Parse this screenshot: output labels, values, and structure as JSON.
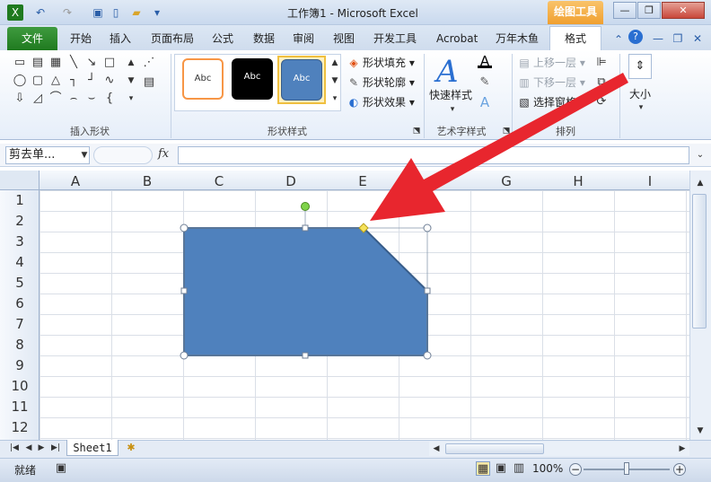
{
  "window": {
    "title": "工作簿1 - Microsoft Excel",
    "tools_tab": "绘图工具",
    "minimize": "—",
    "restore": "❐",
    "close": "✕"
  },
  "ribbon_tabs": [
    "文件",
    "开始",
    "插入",
    "页面布局",
    "公式",
    "数据",
    "审阅",
    "视图",
    "开发工具",
    "Acrobat",
    "万年木鱼",
    "格式"
  ],
  "groups": {
    "insert_shapes": "插入形状",
    "shape_styles": "形状样式",
    "wordart_styles": "艺术字样式",
    "arrange": "排列",
    "size": "大小"
  },
  "shape_style_samples": [
    "Abc",
    "Abc",
    "Abc"
  ],
  "shape_menu": {
    "fill": "形状填充",
    "outline": "形状轮廓",
    "effects": "形状效果"
  },
  "wordart": {
    "quick_styles": "快速样式"
  },
  "arrange": {
    "bring_forward": "上移一层",
    "send_backward": "下移一层",
    "selection_pane": "选择窗格"
  },
  "formula_bar": {
    "name_box": "剪去单...",
    "fx": "fx",
    "value": ""
  },
  "columns": [
    "A",
    "B",
    "C",
    "D",
    "E",
    "F",
    "G",
    "H",
    "I"
  ],
  "rows": [
    "1",
    "2",
    "3",
    "4",
    "5",
    "6",
    "7",
    "8",
    "9",
    "10",
    "11",
    "12"
  ],
  "sheet_tabs": [
    "Sheet1"
  ],
  "status": {
    "ready": "就绪",
    "zoom": "100%"
  },
  "colors": {
    "shape_fill": "#4f81bd",
    "shape_border": "#385d8a",
    "arrow": "#e8262e",
    "format_tab": "#f0a030"
  }
}
